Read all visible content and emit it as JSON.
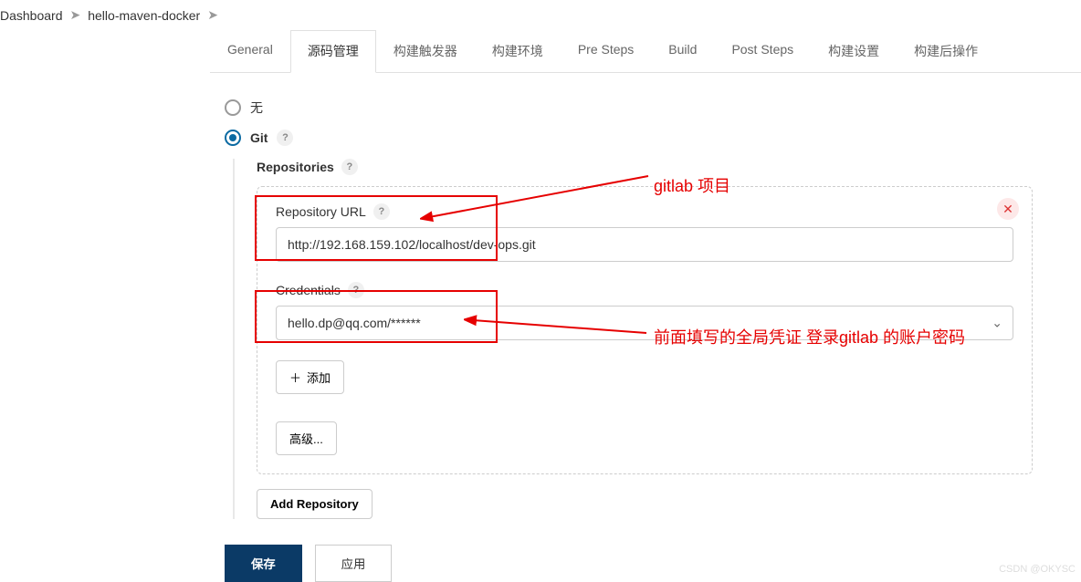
{
  "breadcrumb": {
    "dashboard": "Dashboard",
    "project": "hello-maven-docker"
  },
  "tabs": {
    "general": "General",
    "scm": "源码管理",
    "triggers": "构建触发器",
    "env": "构建环境",
    "pre": "Pre Steps",
    "build": "Build",
    "post": "Post Steps",
    "settings": "构建设置",
    "postbuild": "构建后操作"
  },
  "scm": {
    "none": "无",
    "git": "Git",
    "repositories_label": "Repositories",
    "repo_url_label": "Repository URL",
    "repo_url_value": "http://192.168.159.102/localhost/dev-ops.git",
    "credentials_label": "Credentials",
    "credentials_value": "hello.dp@qq.com/******",
    "add_btn": "添加",
    "advanced_btn": "高级...",
    "add_repo_btn": "Add Repository"
  },
  "buttons": {
    "save": "保存",
    "apply": "应用"
  },
  "annotations": {
    "gitlab_project": "gitlab 项目",
    "credentials_note": "前面填写的全局凭证 登录gitlab 的账户密码"
  },
  "watermark": "CSDN @OKYSC"
}
